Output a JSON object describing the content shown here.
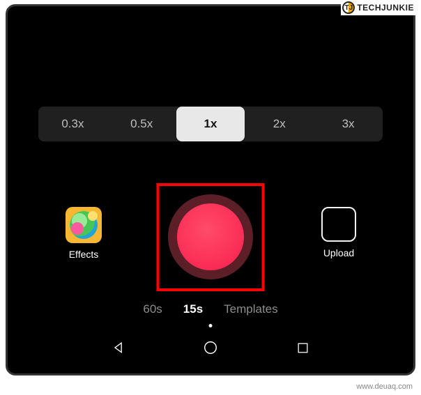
{
  "watermark": {
    "logo_text": "TJ",
    "brand": "TECHJUNKIE"
  },
  "speed": {
    "options": [
      "0.3x",
      "0.5x",
      "1x",
      "2x",
      "3x"
    ],
    "selected_index": 2
  },
  "effects": {
    "label": "Effects"
  },
  "upload": {
    "label": "Upload"
  },
  "record": {
    "highlight_color": "#ff0000",
    "button_color": "#fa2c55"
  },
  "modes": {
    "options": [
      "60s",
      "15s",
      "Templates"
    ],
    "selected_index": 1
  },
  "nav": {
    "back": "Back",
    "home": "Home",
    "recent": "Recent apps"
  },
  "credit": "www.deuaq.com"
}
